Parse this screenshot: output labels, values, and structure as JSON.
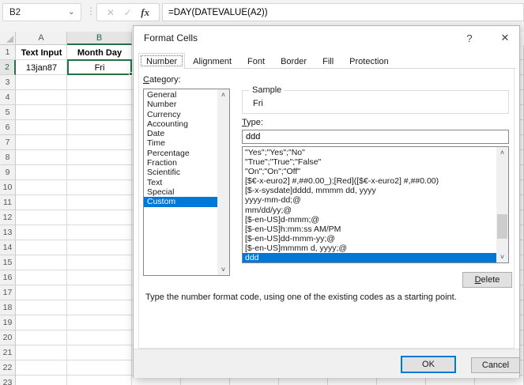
{
  "formula_bar": {
    "name_box": "B2",
    "name_box_chevron": "⌄",
    "menu_dots": "⋮",
    "cancel_icon": "✕",
    "enter_icon": "✓",
    "fx_icon": "fx",
    "formula": "=DAY(DATEVALUE(A2))"
  },
  "sheet": {
    "columns": [
      {
        "label": "A",
        "selected": false
      },
      {
        "label": "B",
        "selected": true
      }
    ],
    "row_numbers": [
      "1",
      "2",
      "3",
      "4",
      "5",
      "6",
      "7",
      "8",
      "9",
      "10",
      "11",
      "12",
      "13",
      "14",
      "15",
      "16",
      "17",
      "18",
      "19",
      "20",
      "21",
      "22",
      "23"
    ],
    "selected_row": "2",
    "cells": {
      "a1": "Text Input",
      "b1": "Month Day",
      "a2": "13jan87",
      "b2": "Fri"
    },
    "selected_cell": "B2"
  },
  "dialog": {
    "title": "Format Cells",
    "help_icon": "?",
    "close_icon": "✕",
    "tabs": [
      {
        "label": "Number",
        "active": true
      },
      {
        "label": "Alignment",
        "active": false
      },
      {
        "label": "Font",
        "active": false
      },
      {
        "label": "Border",
        "active": false
      },
      {
        "label": "Fill",
        "active": false
      },
      {
        "label": "Protection",
        "active": false
      }
    ],
    "category_label": "Category:",
    "categories": [
      "General",
      "Number",
      "Currency",
      "Accounting",
      "Date",
      "Time",
      "Percentage",
      "Fraction",
      "Scientific",
      "Text",
      "Special",
      "Custom"
    ],
    "selected_category": "Custom",
    "sample_label": "Sample",
    "sample_value": "Fri",
    "type_label": "Type:",
    "type_value": "ddd",
    "format_codes": [
      "\"Yes\";\"Yes\";\"No\"",
      "\"True\";\"True\";\"False\"",
      "\"On\";\"On\";\"Off\"",
      "[$€-x-euro2] #,##0.00_);[Red]([$€-x-euro2] #,##0.00)",
      "[$-x-sysdate]dddd, mmmm dd, yyyy",
      "yyyy-mm-dd;@",
      "mm/dd/yy;@",
      "[$-en-US]d-mmm;@",
      "[$-en-US]h:mm:ss AM/PM",
      "[$-en-US]dd-mmm-yy;@",
      "[$-en-US]mmmm d, yyyy;@",
      "ddd"
    ],
    "selected_code_index": 11,
    "delete_button": "Delete",
    "help_text": "Type the number format code, using one of the existing codes as a starting point.",
    "ok_button": "OK",
    "cancel_button": "Cancel",
    "scroll_up_icon": "˄",
    "scroll_down_icon": "˅"
  },
  "colors": {
    "excel_green": "#217346",
    "selection_blue": "#0078d7",
    "gridline": "#d9d9d9",
    "dialog_footer": "#f0f0f0"
  }
}
